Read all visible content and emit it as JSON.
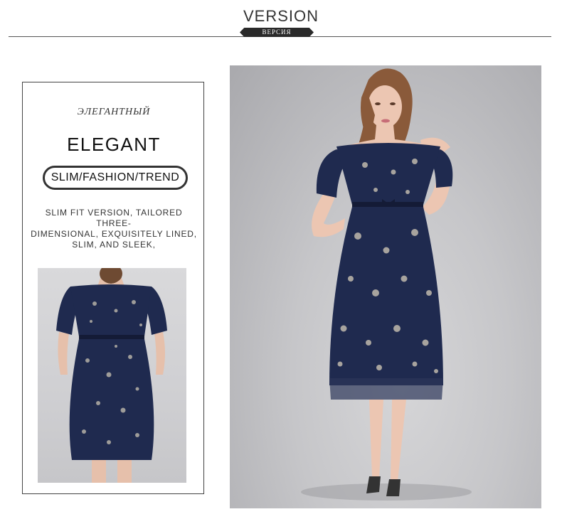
{
  "header": {
    "title": "VERSION",
    "tag": "ВЕРСИЯ"
  },
  "card": {
    "title_ru": "ЭЛЕГАНТНЫЙ",
    "title_en": "ELEGANT",
    "pill": "SLIM/FASHION/TREND",
    "description_lines": [
      "SLIM FIT VERSION, TAILORED THREE-",
      "DIMENSIONAL, EXQUISITELY LINED,",
      "SLIM, AND SLEEK,"
    ]
  },
  "colors": {
    "dress": "#1f2a4f",
    "dress_dark": "#141b36",
    "embroidery": "#c9c2b2",
    "skin": "#e9c3b0",
    "hair": "#8a5a3a",
    "backdrop": "#c8c8cb"
  },
  "images": {
    "back_view": "dress-back-photo",
    "front_view": "model-front-photo"
  }
}
